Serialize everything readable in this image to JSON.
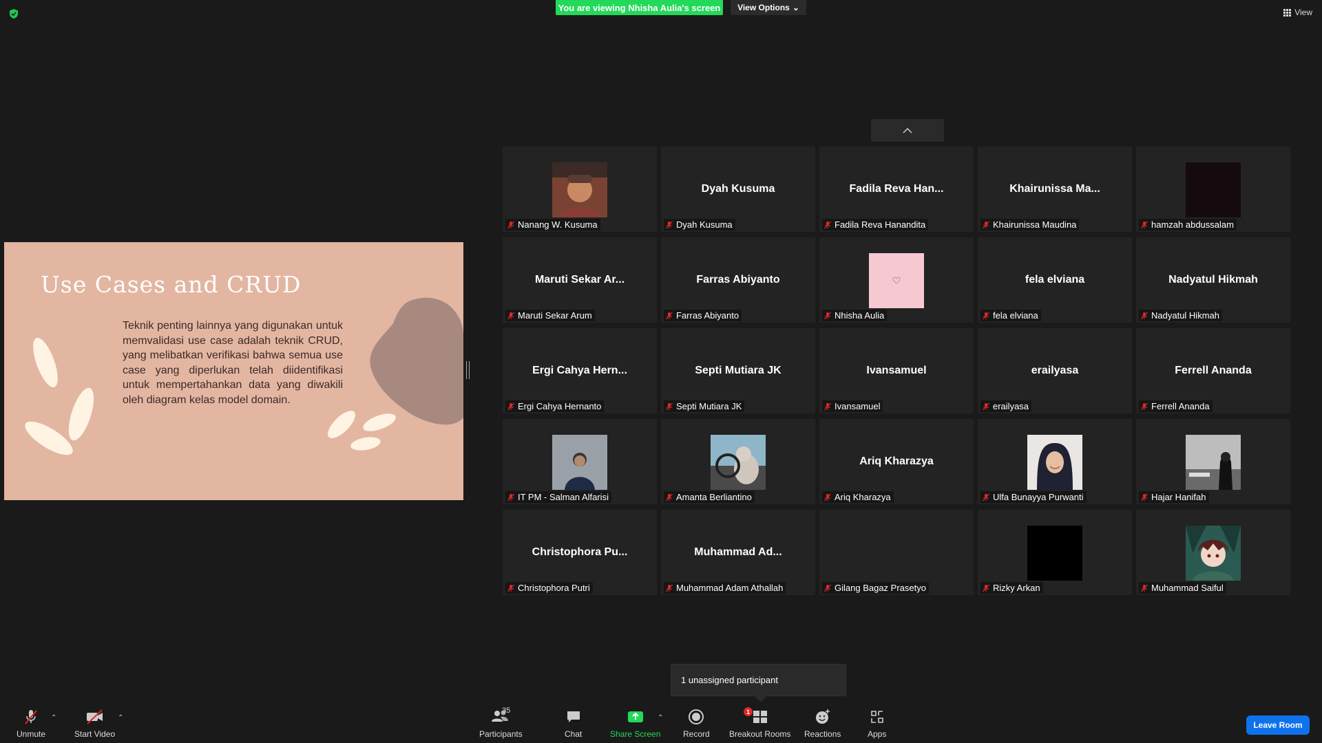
{
  "top": {
    "viewing_banner": "You are viewing Nhisha Aulia's screen",
    "view_options": "View Options",
    "view_label": "View"
  },
  "slide": {
    "title": "Use Cases and CRUD",
    "body": "Teknik penting lainnya yang digunakan untuk memvalidasi use case adalah teknik CRUD, yang melibatkan verifikasi bahwa semua use case yang diperlukan telah diidentifikasi untuk mempertahankan data yang diwakili oleh diagram kelas model domain."
  },
  "participants": [
    {
      "name": "Nanang W. Kusuma",
      "center": "",
      "avatar": "photo-man-beanie"
    },
    {
      "name": "Dyah Kusuma",
      "center": "Dyah Kusuma",
      "avatar": ""
    },
    {
      "name": "Fadila Reva Hanandita",
      "center": "Fadila Reva Han...",
      "avatar": ""
    },
    {
      "name": "Khairunissa Maudina",
      "center": "Khairunissa Ma...",
      "avatar": ""
    },
    {
      "name": "hamzah abdussalam",
      "center": "",
      "avatar": "dark-square"
    },
    {
      "name": "Maruti Sekar Arum",
      "center": "Maruti Sekar Ar...",
      "avatar": ""
    },
    {
      "name": "Farras Abiyanto",
      "center": "Farras Abiyanto",
      "avatar": ""
    },
    {
      "name": "Nhisha Aulia",
      "center": "",
      "avatar": "pink-heart"
    },
    {
      "name": "fela elviana",
      "center": "fela elviana",
      "avatar": ""
    },
    {
      "name": "Nadyatul Hikmah",
      "center": "Nadyatul Hikmah",
      "avatar": ""
    },
    {
      "name": "Ergi Cahya Hernanto",
      "center": "Ergi Cahya Hern...",
      "avatar": ""
    },
    {
      "name": "Septi Mutiara JK",
      "center": "Septi Mutiara JK",
      "avatar": ""
    },
    {
      "name": "Ivansamuel",
      "center": "Ivansamuel",
      "avatar": ""
    },
    {
      "name": "erailyasa",
      "center": "erailyasa",
      "avatar": ""
    },
    {
      "name": "Ferrell Ananda",
      "center": "Ferrell Ananda",
      "avatar": ""
    },
    {
      "name": "IT PM - Salman Alfarisi",
      "center": "",
      "avatar": "photo-person-wall"
    },
    {
      "name": "Amanta Berliantino",
      "center": "",
      "avatar": "photo-cat-car"
    },
    {
      "name": "Ariq Kharazya",
      "center": "Ariq Kharazya",
      "avatar": ""
    },
    {
      "name": "Ulfa Bunayya Purwanti",
      "center": "",
      "avatar": "photo-hijab"
    },
    {
      "name": "Hajar Hanifah",
      "center": "",
      "avatar": "photo-bw"
    },
    {
      "name": "Christophora Putri",
      "center": "Christophora Pu...",
      "avatar": ""
    },
    {
      "name": "Muhammad Adam Athallah",
      "center": "Muhammad Ad...",
      "avatar": ""
    },
    {
      "name": "Gilang Bagaz Prasetyo",
      "center": "",
      "avatar": ""
    },
    {
      "name": "Rizky Arkan",
      "center": "",
      "avatar": "black-square"
    },
    {
      "name": "Muhammad Saiful",
      "center": "",
      "avatar": "photo-anime"
    }
  ],
  "popover": {
    "unassigned": "1 unassigned participant"
  },
  "toolbar": {
    "unmute": "Unmute",
    "start_video": "Start Video",
    "participants": "Participants",
    "participants_count": "35",
    "chat": "Chat",
    "share_screen": "Share Screen",
    "record": "Record",
    "breakout_rooms": "Breakout Rooms",
    "breakout_badge": "1",
    "reactions": "Reactions",
    "apps": "Apps",
    "leave": "Leave Room"
  },
  "colors": {
    "banner_green": "#23d959",
    "leave_blue": "#0e72ed",
    "slide_bg": "#e3b6a2",
    "mic_off_red": "#e02828"
  }
}
